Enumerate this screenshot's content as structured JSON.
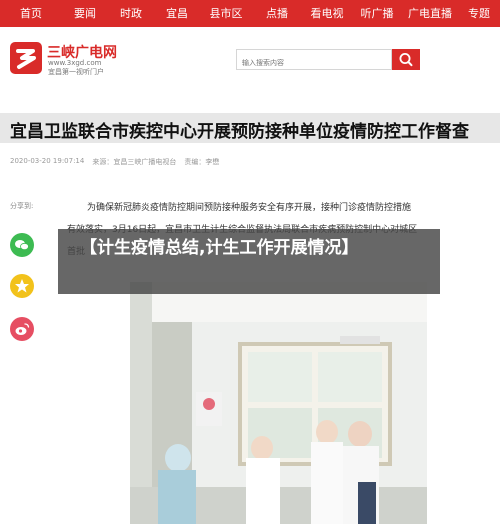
{
  "nav": {
    "items": [
      "首页",
      "要闻",
      "时政",
      "宜昌",
      "县市区",
      "点播",
      "看电视",
      "听广播",
      "广电直播",
      "专题"
    ]
  },
  "logo": {
    "title": "三峡广电网",
    "url": "www.3xgd.com",
    "subtitle": "宜昌第一视听门户"
  },
  "search": {
    "placeholder": "输入搜索内容"
  },
  "article": {
    "title": "宜昌卫监联合市疾控中心开展预防接种单位疫情防控工作督查",
    "date": "2020-03-20 19:07:14",
    "source": "来源：宜昌三峡广播电视台",
    "editor": "责编：李懋",
    "paragraph_line1": "为确保新冠肺炎疫情防控期间预防接种服务安全有序开展，接种门诊疫情防控措施",
    "paragraph_line2": "有效落实，3月16日起，宜昌市卫生计生综合监督执法局联合市疾病预防控制中心对城区",
    "paragraph_line3_start": "首批"
  },
  "share": {
    "label": "分享到:"
  },
  "overlay": {
    "title": "【计生疫情总结,计生工作开展情况】"
  },
  "colors": {
    "brand_red": "#d92b29",
    "wechat_green": "#3dbb52",
    "qzone_yellow": "#f2c21b",
    "weibo_pink": "#e64e62"
  },
  "icons": [
    "logo-mark-icon",
    "search-icon",
    "wechat-icon",
    "qzone-icon",
    "weibo-icon"
  ]
}
